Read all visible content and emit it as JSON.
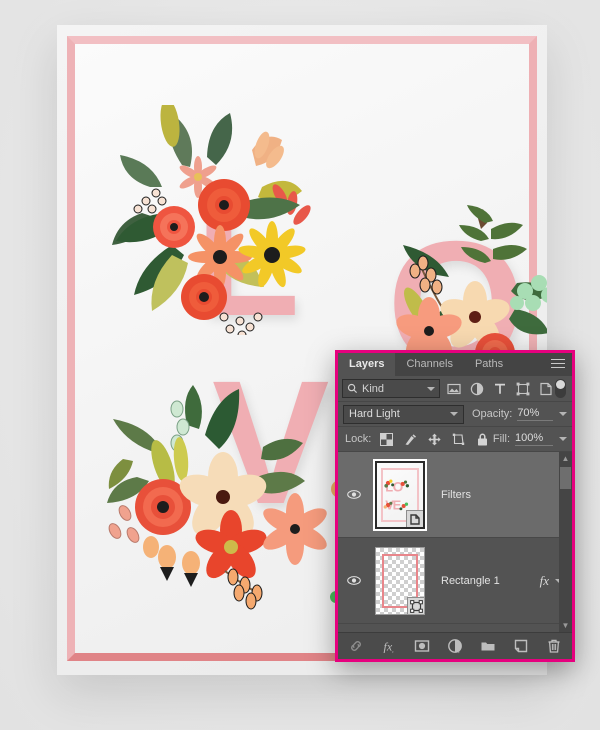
{
  "artwork": {
    "title": "LOVE floral poster mockup",
    "letters": [
      "L",
      "O",
      "V",
      "E"
    ],
    "frame_color": "#f0b9bd",
    "letter_color": "#f0aeb3",
    "canvas_background": "#e9e9e9"
  },
  "panel": {
    "title": "Layers",
    "tabs": [
      {
        "label": "Layers",
        "active": true
      },
      {
        "label": "Channels",
        "active": false
      },
      {
        "label": "Paths",
        "active": false
      }
    ],
    "menu_icon": "hamburger-menu-icon",
    "filter": {
      "search_icon": "search-icon",
      "kind_label": "Kind",
      "icons": [
        "pixel-layer-filter-icon",
        "adjustment-layer-filter-icon",
        "type-layer-filter-icon",
        "shape-layer-filter-icon",
        "smart-object-filter-icon"
      ],
      "toggle": "filter-enable-toggle"
    },
    "blend": {
      "mode": "Hard Light",
      "opacity_label": "Opacity:",
      "opacity_value": "70%"
    },
    "lock": {
      "label": "Lock:",
      "icons": [
        "lock-transparent-pixels-icon",
        "lock-image-pixels-icon",
        "lock-position-icon",
        "lock-artboard-nesting-icon",
        "lock-all-icon"
      ],
      "fill_label": "Fill:",
      "fill_value": "100%"
    },
    "layers": [
      {
        "name": "Filters",
        "visible": true,
        "selected": true,
        "thumb_type": "poster",
        "badge": "smart-object-badge-icon",
        "has_fx": false
      },
      {
        "name": "Rectangle 1",
        "visible": true,
        "selected": false,
        "thumb_type": "transparent-rectangle",
        "badge": "shape-layer-badge-icon",
        "has_fx": true,
        "fx_label": "fx"
      }
    ],
    "bottom_buttons": [
      "link-layers-icon",
      "add-layer-style-icon",
      "add-layer-mask-icon",
      "new-adjustment-layer-icon",
      "new-group-icon",
      "new-layer-icon",
      "delete-layer-icon"
    ],
    "scrollbar": {
      "up_arrow": "scroll-up-arrow-icon",
      "down_arrow": "scroll-down-arrow-icon"
    },
    "colors": {
      "border": "#e6007e",
      "panel_bg": "#535353",
      "row_selected": "#6b6b6b",
      "text": "#d6d6d6"
    }
  }
}
